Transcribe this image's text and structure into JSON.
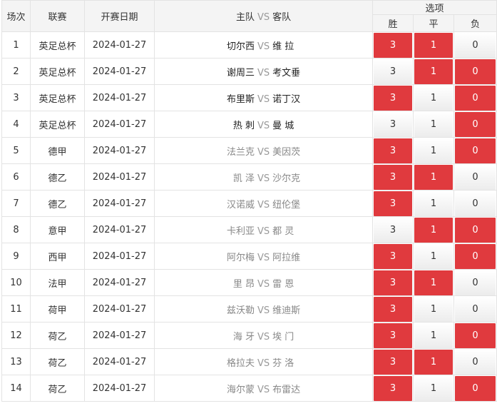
{
  "headers": {
    "index": "场次",
    "league": "联赛",
    "date": "开赛日期",
    "home": "主队",
    "vs": "VS",
    "away": "客队",
    "options": "选项",
    "win": "胜",
    "draw": "平",
    "lose": "负"
  },
  "colors": {
    "selected": "#e03a3e",
    "unselected": "#f1f1f1"
  },
  "rows": [
    {
      "no": "1",
      "league": "英足总杯",
      "date": "2024-01-27",
      "home": "切尔西",
      "away": "维 拉",
      "team_style": "strong",
      "win": {
        "v": "3",
        "sel": true
      },
      "draw": {
        "v": "1",
        "sel": true
      },
      "lose": {
        "v": "0",
        "sel": false
      }
    },
    {
      "no": "2",
      "league": "英足总杯",
      "date": "2024-01-27",
      "home": "谢周三",
      "away": "考文垂",
      "team_style": "strong",
      "win": {
        "v": "3",
        "sel": false
      },
      "draw": {
        "v": "1",
        "sel": true
      },
      "lose": {
        "v": "0",
        "sel": true
      }
    },
    {
      "no": "3",
      "league": "英足总杯",
      "date": "2024-01-27",
      "home": "布里斯",
      "away": "诺丁汉",
      "team_style": "strong",
      "win": {
        "v": "3",
        "sel": true
      },
      "draw": {
        "v": "1",
        "sel": false
      },
      "lose": {
        "v": "0",
        "sel": true
      }
    },
    {
      "no": "4",
      "league": "英足总杯",
      "date": "2024-01-27",
      "home": "热 刺",
      "away": "曼 城",
      "team_style": "strong",
      "win": {
        "v": "3",
        "sel": false
      },
      "draw": {
        "v": "1",
        "sel": false
      },
      "lose": {
        "v": "0",
        "sel": true
      }
    },
    {
      "no": "5",
      "league": "德甲",
      "date": "2024-01-27",
      "home": "法兰克",
      "away": "美因茨",
      "team_style": "weak",
      "win": {
        "v": "3",
        "sel": true
      },
      "draw": {
        "v": "1",
        "sel": false
      },
      "lose": {
        "v": "0",
        "sel": true
      }
    },
    {
      "no": "6",
      "league": "德乙",
      "date": "2024-01-27",
      "home": "凯 泽",
      "away": "沙尔克",
      "team_style": "weak",
      "win": {
        "v": "3",
        "sel": true
      },
      "draw": {
        "v": "1",
        "sel": true
      },
      "lose": {
        "v": "0",
        "sel": false
      }
    },
    {
      "no": "7",
      "league": "德乙",
      "date": "2024-01-27",
      "home": "汉诺威",
      "away": "纽伦堡",
      "team_style": "weak",
      "win": {
        "v": "3",
        "sel": true
      },
      "draw": {
        "v": "1",
        "sel": false
      },
      "lose": {
        "v": "0",
        "sel": false
      }
    },
    {
      "no": "8",
      "league": "意甲",
      "date": "2024-01-27",
      "home": "卡利亚",
      "away": "都 灵",
      "team_style": "weak",
      "win": {
        "v": "3",
        "sel": false
      },
      "draw": {
        "v": "1",
        "sel": true
      },
      "lose": {
        "v": "0",
        "sel": true
      }
    },
    {
      "no": "9",
      "league": "西甲",
      "date": "2024-01-27",
      "home": "阿尔梅",
      "away": "阿拉维",
      "team_style": "weak",
      "win": {
        "v": "3",
        "sel": true
      },
      "draw": {
        "v": "1",
        "sel": false
      },
      "lose": {
        "v": "0",
        "sel": true
      }
    },
    {
      "no": "10",
      "league": "法甲",
      "date": "2024-01-27",
      "home": "里 昂",
      "away": "雷 恩",
      "team_style": "weak",
      "win": {
        "v": "3",
        "sel": true
      },
      "draw": {
        "v": "1",
        "sel": true
      },
      "lose": {
        "v": "0",
        "sel": false
      }
    },
    {
      "no": "11",
      "league": "荷甲",
      "date": "2024-01-27",
      "home": "兹沃勒",
      "away": "维迪斯",
      "team_style": "weak",
      "win": {
        "v": "3",
        "sel": true
      },
      "draw": {
        "v": "1",
        "sel": false
      },
      "lose": {
        "v": "0",
        "sel": false
      }
    },
    {
      "no": "12",
      "league": "荷乙",
      "date": "2024-01-27",
      "home": "海 牙",
      "away": "埃 门",
      "team_style": "weak",
      "win": {
        "v": "3",
        "sel": true
      },
      "draw": {
        "v": "1",
        "sel": false
      },
      "lose": {
        "v": "0",
        "sel": true
      }
    },
    {
      "no": "13",
      "league": "荷乙",
      "date": "2024-01-27",
      "home": "格拉夫",
      "away": "芬 洛",
      "team_style": "weak",
      "win": {
        "v": "3",
        "sel": true
      },
      "draw": {
        "v": "1",
        "sel": true
      },
      "lose": {
        "v": "0",
        "sel": false
      }
    },
    {
      "no": "14",
      "league": "荷乙",
      "date": "2024-01-27",
      "home": "海尔蒙",
      "away": "布雷达",
      "team_style": "weak",
      "win": {
        "v": "3",
        "sel": true
      },
      "draw": {
        "v": "1",
        "sel": false
      },
      "lose": {
        "v": "0",
        "sel": true
      }
    }
  ]
}
